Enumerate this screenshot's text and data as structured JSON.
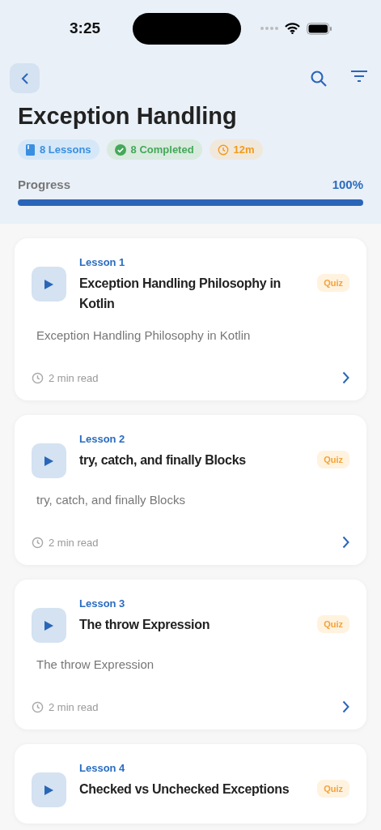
{
  "status_bar": {
    "time": "3:25"
  },
  "header": {
    "title": "Exception Handling",
    "stats": [
      {
        "kind": "lessons",
        "label": "8 Lessons"
      },
      {
        "kind": "completed",
        "label": "8 Completed"
      },
      {
        "kind": "duration",
        "label": "12m"
      }
    ],
    "progress": {
      "label": "Progress",
      "reading": "100%",
      "level": 1
    }
  },
  "lessons": [
    {
      "number": "Lesson 1",
      "title": "Exception Handling Philosophy in Kotlin",
      "badge": "Quiz",
      "description": "Exception Handling Philosophy in Kotlin",
      "read_time": "2 min read"
    },
    {
      "number": "Lesson 2",
      "title": "try, catch, and finally Blocks",
      "badge": "Quiz",
      "description": "try, catch, and finally Blocks",
      "read_time": "2 min read"
    },
    {
      "number": "Lesson 3",
      "title": "The throw Expression",
      "badge": "Quiz",
      "description": "The throw Expression",
      "read_time": "2 min read"
    },
    {
      "number": "Lesson 4",
      "title": "Checked vs Unchecked Exceptions",
      "badge": "Quiz"
    }
  ]
}
